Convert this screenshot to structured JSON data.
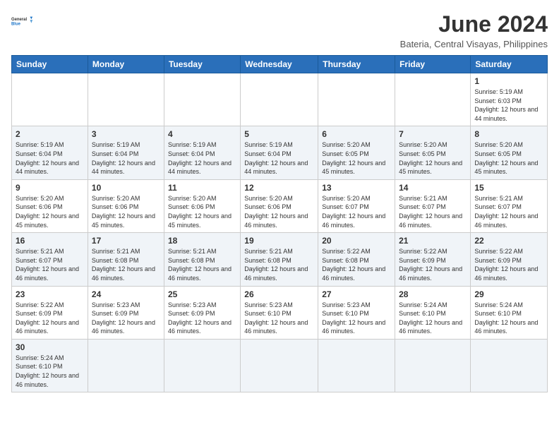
{
  "header": {
    "logo_general": "General",
    "logo_blue": "Blue",
    "month_title": "June 2024",
    "subtitle": "Bateria, Central Visayas, Philippines"
  },
  "days_of_week": [
    "Sunday",
    "Monday",
    "Tuesday",
    "Wednesday",
    "Thursday",
    "Friday",
    "Saturday"
  ],
  "weeks": [
    [
      {
        "day": "",
        "info": ""
      },
      {
        "day": "",
        "info": ""
      },
      {
        "day": "",
        "info": ""
      },
      {
        "day": "",
        "info": ""
      },
      {
        "day": "",
        "info": ""
      },
      {
        "day": "",
        "info": ""
      },
      {
        "day": "1",
        "info": "Sunrise: 5:19 AM\nSunset: 6:03 PM\nDaylight: 12 hours and 44 minutes."
      }
    ],
    [
      {
        "day": "2",
        "info": "Sunrise: 5:19 AM\nSunset: 6:04 PM\nDaylight: 12 hours and 44 minutes."
      },
      {
        "day": "3",
        "info": "Sunrise: 5:19 AM\nSunset: 6:04 PM\nDaylight: 12 hours and 44 minutes."
      },
      {
        "day": "4",
        "info": "Sunrise: 5:19 AM\nSunset: 6:04 PM\nDaylight: 12 hours and 44 minutes."
      },
      {
        "day": "5",
        "info": "Sunrise: 5:19 AM\nSunset: 6:04 PM\nDaylight: 12 hours and 44 minutes."
      },
      {
        "day": "6",
        "info": "Sunrise: 5:20 AM\nSunset: 6:05 PM\nDaylight: 12 hours and 45 minutes."
      },
      {
        "day": "7",
        "info": "Sunrise: 5:20 AM\nSunset: 6:05 PM\nDaylight: 12 hours and 45 minutes."
      },
      {
        "day": "8",
        "info": "Sunrise: 5:20 AM\nSunset: 6:05 PM\nDaylight: 12 hours and 45 minutes."
      }
    ],
    [
      {
        "day": "9",
        "info": "Sunrise: 5:20 AM\nSunset: 6:06 PM\nDaylight: 12 hours and 45 minutes."
      },
      {
        "day": "10",
        "info": "Sunrise: 5:20 AM\nSunset: 6:06 PM\nDaylight: 12 hours and 45 minutes."
      },
      {
        "day": "11",
        "info": "Sunrise: 5:20 AM\nSunset: 6:06 PM\nDaylight: 12 hours and 45 minutes."
      },
      {
        "day": "12",
        "info": "Sunrise: 5:20 AM\nSunset: 6:06 PM\nDaylight: 12 hours and 46 minutes."
      },
      {
        "day": "13",
        "info": "Sunrise: 5:20 AM\nSunset: 6:07 PM\nDaylight: 12 hours and 46 minutes."
      },
      {
        "day": "14",
        "info": "Sunrise: 5:21 AM\nSunset: 6:07 PM\nDaylight: 12 hours and 46 minutes."
      },
      {
        "day": "15",
        "info": "Sunrise: 5:21 AM\nSunset: 6:07 PM\nDaylight: 12 hours and 46 minutes."
      }
    ],
    [
      {
        "day": "16",
        "info": "Sunrise: 5:21 AM\nSunset: 6:07 PM\nDaylight: 12 hours and 46 minutes."
      },
      {
        "day": "17",
        "info": "Sunrise: 5:21 AM\nSunset: 6:08 PM\nDaylight: 12 hours and 46 minutes."
      },
      {
        "day": "18",
        "info": "Sunrise: 5:21 AM\nSunset: 6:08 PM\nDaylight: 12 hours and 46 minutes."
      },
      {
        "day": "19",
        "info": "Sunrise: 5:21 AM\nSunset: 6:08 PM\nDaylight: 12 hours and 46 minutes."
      },
      {
        "day": "20",
        "info": "Sunrise: 5:22 AM\nSunset: 6:08 PM\nDaylight: 12 hours and 46 minutes."
      },
      {
        "day": "21",
        "info": "Sunrise: 5:22 AM\nSunset: 6:09 PM\nDaylight: 12 hours and 46 minutes."
      },
      {
        "day": "22",
        "info": "Sunrise: 5:22 AM\nSunset: 6:09 PM\nDaylight: 12 hours and 46 minutes."
      }
    ],
    [
      {
        "day": "23",
        "info": "Sunrise: 5:22 AM\nSunset: 6:09 PM\nDaylight: 12 hours and 46 minutes."
      },
      {
        "day": "24",
        "info": "Sunrise: 5:23 AM\nSunset: 6:09 PM\nDaylight: 12 hours and 46 minutes."
      },
      {
        "day": "25",
        "info": "Sunrise: 5:23 AM\nSunset: 6:09 PM\nDaylight: 12 hours and 46 minutes."
      },
      {
        "day": "26",
        "info": "Sunrise: 5:23 AM\nSunset: 6:10 PM\nDaylight: 12 hours and 46 minutes."
      },
      {
        "day": "27",
        "info": "Sunrise: 5:23 AM\nSunset: 6:10 PM\nDaylight: 12 hours and 46 minutes."
      },
      {
        "day": "28",
        "info": "Sunrise: 5:24 AM\nSunset: 6:10 PM\nDaylight: 12 hours and 46 minutes."
      },
      {
        "day": "29",
        "info": "Sunrise: 5:24 AM\nSunset: 6:10 PM\nDaylight: 12 hours and 46 minutes."
      }
    ],
    [
      {
        "day": "30",
        "info": "Sunrise: 5:24 AM\nSunset: 6:10 PM\nDaylight: 12 hours and 46 minutes."
      },
      {
        "day": "",
        "info": ""
      },
      {
        "day": "",
        "info": ""
      },
      {
        "day": "",
        "info": ""
      },
      {
        "day": "",
        "info": ""
      },
      {
        "day": "",
        "info": ""
      },
      {
        "day": "",
        "info": ""
      }
    ]
  ]
}
